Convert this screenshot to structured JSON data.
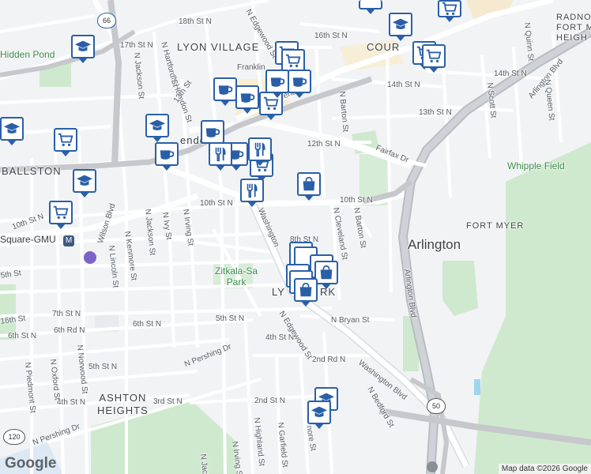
{
  "map": {
    "brand": "Google",
    "attribution": "Map data ©2026 Google",
    "neighborhoods": {
      "lyon_village": "LYON VILLAGE",
      "ballston": "BALLSTON",
      "ashton_heights": "ASHTON\nHEIGHTS",
      "fort_myer": "FORT MYER",
      "courthouse": "COUR",
      "radnor": "RADNOR\nFORT M\nHEIGH",
      "lyon_park": "LY",
      "lyon_park_tail": "RK",
      "clarendon": "endo"
    },
    "city": "Arlington",
    "parks": {
      "zitkala_sa": "Zitkala-Sa\nPark",
      "hidden_pond": "Hidden Pond",
      "whipple": "Whipple Field"
    },
    "transit": {
      "station": "Square-GMU"
    },
    "shields": {
      "i66": "66",
      "us50": "50",
      "va120": "120"
    },
    "streets": {
      "s10th": "10th St N",
      "s10th_w": "10th St N",
      "s10th_far_w": "10th St N",
      "s12th": "12th St N",
      "s13th": "13th St N",
      "s13th_w": "13th St",
      "s14th": "14th St N",
      "s14th_e": "14th St N",
      "s16th": "16th St N",
      "s16th_w": "16th St",
      "s17th": "17th St N",
      "s18th": "18th St N",
      "s7th": "7th St N",
      "s6th": "6th St N",
      "s6th_w": "6th St N",
      "s6th_rd": "6th Rd N",
      "s5th": "5th St N",
      "s5th_w": "5th St N",
      "s4th": "4th St N",
      "s4th_w": "4th St N",
      "s3rd": "3rd St N",
      "s2nd": "2nd St N",
      "s2nd_rd": "2nd Rd N",
      "wilson": "Wilson Blvd",
      "washington": "Washington Blvd",
      "washington_n": "Washington",
      "arlington_blvd": "Arlington Blvd",
      "arlington_blvd_ne": "Arlington Blvd",
      "fairfax": "Fairfax Dr",
      "clarendon_blvd": "Clarendon",
      "pershing": "N Pershing Dr",
      "pershing_w": "N Pershing Dr",
      "edgewood": "N Edgewood St",
      "edgewood_n": "N Edgewood St",
      "cleveland": "N Cleveland St",
      "barton": "N Barton St",
      "barton_n": "N Barton St",
      "bryan": "N Bryan St",
      "bedford": "N Bedford St",
      "irving": "N Irving St",
      "irving_s": "N Irving St",
      "ivy": "N Ivy St",
      "jackson": "N Jackson St",
      "jackson_n": "N Jackson St",
      "kenmore": "N Kenmore St",
      "lincoln": "N Lincoln St",
      "norwood": "N Norwood St",
      "oxford": "N Oxford St",
      "piedmont": "N Piedmont St",
      "herndon": "N Herndon St",
      "hartford": "N Hartford St",
      "highland": "N Highland St",
      "garfield": "N Garfield St",
      "quinn": "N Quinn St",
      "queen": "N Queen St",
      "scott": "N Scott St",
      "franklin": "Franklin",
      "s8th": "8th St N",
      "s2nd_rd_w": "2nd Rd",
      "jackson_s": "N Jacks",
      "fillmore": "nore St",
      "fifth_w": "5th St"
    },
    "markers": [
      {
        "icon": "education",
        "label": "school"
      },
      {
        "icon": "shopping-cart",
        "label": "grocery"
      },
      {
        "icon": "education",
        "label": "school"
      },
      {
        "icon": "education",
        "label": "school"
      },
      {
        "icon": "shopping-cart",
        "label": "grocery"
      },
      {
        "icon": "coffee",
        "label": "cafe"
      },
      {
        "icon": "shopping-cart",
        "label": "grocery"
      },
      {
        "icon": "restaurant",
        "label": "restaurant"
      },
      {
        "icon": "shopping-bag",
        "label": "store"
      },
      {
        "icon": "shopping-bag",
        "label": "store"
      }
    ]
  }
}
